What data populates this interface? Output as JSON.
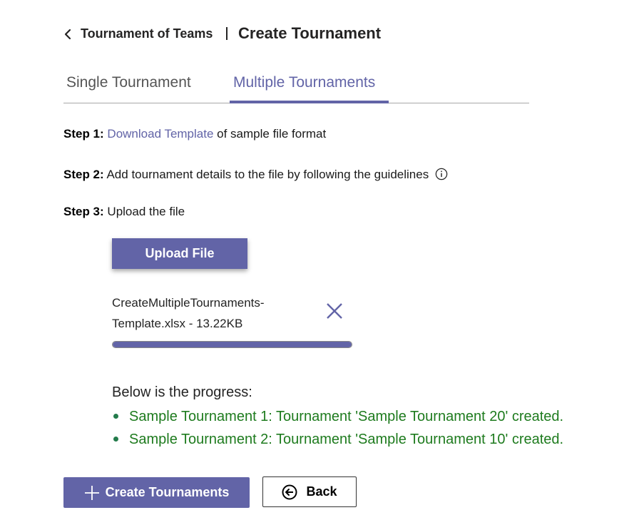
{
  "header": {
    "breadcrumb": "Tournament of Teams",
    "title": "Create Tournament"
  },
  "tabs": [
    {
      "label": "Single Tournament",
      "active": false
    },
    {
      "label": "Multiple Tournaments",
      "active": true
    }
  ],
  "steps": {
    "step1": {
      "label": "Step 1:",
      "link": "Download Template",
      "text": " of sample file format"
    },
    "step2": {
      "label": "Step 2:",
      "text": " Add tournament details to the file by following the guidelines"
    },
    "step3": {
      "label": "Step 3:",
      "text": " Upload the file"
    }
  },
  "upload": {
    "button_label": "Upload File",
    "file_name_line1": "CreateMultipleTournaments-",
    "file_name_line2": "Template.xlsx - 13.22KB",
    "progress_percent": 100
  },
  "progress": {
    "heading": "Below is the progress:",
    "items": [
      "Sample Tournament 1: Tournament 'Sample Tournament 20' created.",
      "Sample Tournament 2: Tournament 'Sample Tournament 10' created."
    ]
  },
  "actions": {
    "create_label": "Create Tournaments",
    "back_label": "Back"
  },
  "colors": {
    "accent": "#6264a7",
    "success": "#237b4b"
  },
  "icons": {
    "back": "chevron-left-icon",
    "info": "info-icon",
    "remove": "close-icon",
    "create": "plus-icon",
    "back_button": "arrow-left-circle-icon"
  }
}
